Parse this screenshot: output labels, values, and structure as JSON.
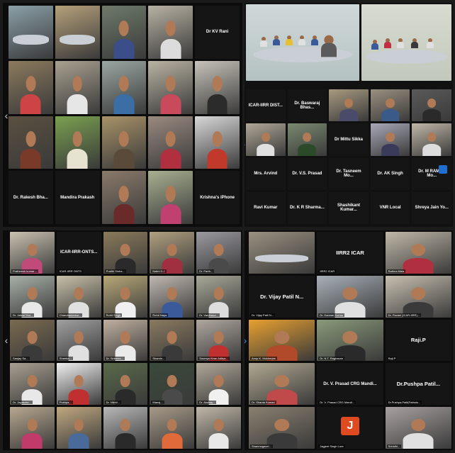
{
  "panels": {
    "top_left": {
      "tiles": [
        {
          "label": "",
          "scene": "room",
          "bg": "#8aa0a8"
        },
        {
          "label": "",
          "scene": "room",
          "bg": "#b5a07a",
          "active": true
        },
        {
          "label": "",
          "scene": "person",
          "bg": "#6e7a6a",
          "shirt": "#3b4e8a"
        },
        {
          "label": "",
          "scene": "person",
          "bg": "#b8b2a3",
          "shirt": "#dcdcdc"
        },
        {
          "name": "Dr KV Rani",
          "scene": "name"
        },
        {
          "label": "",
          "scene": "person",
          "bg": "#8c7a5e",
          "shirt": "#c44"
        },
        {
          "label": "",
          "scene": "person",
          "bg": "#a9a190",
          "shirt": "#e6e6e6"
        },
        {
          "label": "",
          "scene": "person",
          "bg": "#9aa7a3",
          "shirt": "#3b6ea5"
        },
        {
          "label": "",
          "scene": "person",
          "bg": "#b9b3a2",
          "shirt": "#c94a5a"
        },
        {
          "label": "",
          "scene": "person",
          "bg": "#c7c3ba",
          "shirt": "#2b2b2b"
        },
        {
          "label": "",
          "scene": "person",
          "bg": "#5a5040",
          "shirt": "#7a3a2a"
        },
        {
          "label": "",
          "scene": "person",
          "bg": "#7aa050",
          "shirt": "#e8e2d0"
        },
        {
          "label": "",
          "scene": "person",
          "bg": "#a89268",
          "shirt": "#5a4a3a"
        },
        {
          "label": "",
          "scene": "person",
          "bg": "#9a8a80",
          "shirt": "#b03040"
        },
        {
          "label": "",
          "scene": "person",
          "bg": "#d8d8d8",
          "shirt": "#c0392b"
        },
        {
          "name": "Dr. Rakesh Bha...",
          "scene": "name"
        },
        {
          "name": "Mandira Prakash",
          "scene": "name"
        },
        {
          "label": "",
          "scene": "person",
          "bg": "#8a7a6a",
          "shirt": "#6a2a2a"
        },
        {
          "label": "",
          "scene": "person",
          "bg": "#a8b090",
          "shirt": "#c04070"
        },
        {
          "name": "Krishna's iPhone",
          "scene": "name"
        }
      ]
    },
    "top_right": {
      "tiles": [
        {
          "name": "ICAR-IIRR DIST...",
          "scene": "name"
        },
        {
          "name": "Dr. Baswaraj Bhas...",
          "scene": "name"
        },
        {
          "label": "",
          "scene": "person",
          "bg": "#a89a80",
          "shirt": "#4a4a6a"
        },
        {
          "label": "",
          "scene": "person",
          "bg": "#9a9080",
          "shirt": "#3a5a8a"
        },
        {
          "label": "",
          "scene": "person",
          "bg": "#5a5a5a",
          "shirt": "#2a2a2a"
        },
        {
          "label": "",
          "scene": "person",
          "bg": "#b0a898",
          "shirt": "#e0e0e0"
        },
        {
          "label": "",
          "scene": "person",
          "bg": "#7a8a70",
          "shirt": "#2a4a2a"
        },
        {
          "name": "Dr Mittu Sikka",
          "scene": "name"
        },
        {
          "label": "",
          "scene": "person",
          "bg": "#a8a8b8",
          "shirt": "#3a3a5a"
        },
        {
          "label": "",
          "scene": "person",
          "bg": "#c0b8a8",
          "shirt": "#dddddd"
        },
        {
          "name": "Mrs. Arvind",
          "scene": "name"
        },
        {
          "name": "Dr. V.S. Prasad",
          "scene": "name"
        },
        {
          "name": "Dr. Tasneem Mo...",
          "scene": "name"
        },
        {
          "name": "Dr. AK Singh",
          "scene": "name"
        },
        {
          "name": "Dr. M RAMES Mo...",
          "scene": "name"
        },
        {
          "name": "Ravi Kumar",
          "scene": "name"
        },
        {
          "name": "Dr. K R Sharma...",
          "scene": "name"
        },
        {
          "name": "Shashikant Kumar...",
          "scene": "name"
        },
        {
          "name": "VNR Local",
          "scene": "name"
        },
        {
          "name": "Shreya Jain Yo...",
          "scene": "name"
        }
      ]
    },
    "bottom_left": {
      "tiles": [
        {
          "label": "Pratheesh.kumar…",
          "scene": "person",
          "bg": "#c9c2b0",
          "shirt": "#c04a7a"
        },
        {
          "name": "ICAR-IIRR-ONTS...",
          "scene": "name",
          "label": "ICAR-IIRR ONTS"
        },
        {
          "label": "Pratith Sinha...",
          "scene": "person",
          "bg": "#8a7a5a",
          "shirt": "#2a2a2a"
        },
        {
          "label": "Nalini D.J",
          "scene": "person",
          "bg": "#b0a080",
          "shirt": "#a03040"
        },
        {
          "label": "Dr. Parth...",
          "scene": "person",
          "bg": "#9a9aa0",
          "shirt": "#4a4a4a"
        },
        {
          "label": "Dr. Jaisari Kar...",
          "scene": "person",
          "bg": "#a8b0a8",
          "shirt": "#e8e8e8"
        },
        {
          "label": "Chandrashekar...",
          "scene": "person",
          "bg": "#c8c0a8",
          "shirt": "#e0e0e0"
        },
        {
          "label": "Rohit Singh",
          "scene": "person",
          "bg": "#b8a878",
          "shirt": "#f0f0f0",
          "active": true
        },
        {
          "label": "Rohit Naya",
          "scene": "person",
          "bg": "#c0b8b0",
          "shirt": "#3a5a9a"
        },
        {
          "label": "Dr. Vardhana...",
          "scene": "person",
          "bg": "#a8a898",
          "shirt": "#dddddd"
        },
        {
          "label": "Sanjay Sa...",
          "scene": "person",
          "bg": "#7a6a50",
          "shirt": "#3a3a3a"
        },
        {
          "label": "Sheeba...",
          "scene": "person",
          "bg": "#a0a0a0",
          "shirt": "#e0e0e0"
        },
        {
          "label": "Dr. Seleena...",
          "scene": "person",
          "bg": "#c0b0a0",
          "shirt": "#eaeaea"
        },
        {
          "label": "Shamin...",
          "scene": "person",
          "bg": "#8a7a60",
          "shirt": "#3a3a3a"
        },
        {
          "label": "Soumya Kiran Aditya...",
          "scene": "person",
          "bg": "#b0a8a0",
          "shirt": "#c03030"
        },
        {
          "label": "Dr. Jayasree...",
          "scene": "person",
          "bg": "#a8a090",
          "shirt": "#e8e8e8"
        },
        {
          "label": "Pushpa...",
          "scene": "person",
          "bg": "#f0f0f0",
          "shirt": "#c03030"
        },
        {
          "label": "Dr. Nikhil...",
          "scene": "person",
          "bg": "#5a6a4a",
          "shirt": "#2a2a2a"
        },
        {
          "label": "Manoj...",
          "scene": "person",
          "bg": "#3a4a3a",
          "shirt": "#4a4a4a"
        },
        {
          "label": "Dr. Akshay...",
          "scene": "person",
          "bg": "#b0a898",
          "shirt": "#f0f0f0"
        },
        {
          "label": "",
          "scene": "person",
          "bg": "#b8a890",
          "shirt": "#c03a6a"
        },
        {
          "label": "",
          "scene": "person",
          "bg": "#c0a880",
          "shirt": "#4a6a9a"
        },
        {
          "label": "",
          "scene": "person",
          "bg": "#b8b8b8",
          "shirt": "#2a2a2a"
        },
        {
          "label": "",
          "scene": "person",
          "bg": "#a89a88",
          "shirt": "#e06a3a"
        },
        {
          "label": "",
          "scene": "person",
          "bg": "#c0b8a8",
          "shirt": "#e8e8e8"
        }
      ]
    },
    "bottom_right": {
      "tiles": [
        {
          "label": "",
          "scene": "room",
          "bg": "#9a9080"
        },
        {
          "name": "IIRR2 ICAR",
          "scene": "name",
          "big": true,
          "label": "IIRR2 ICAR"
        },
        {
          "label": "Rathna Mala",
          "scene": "person",
          "bg": "#c0b8a8",
          "shirt": "#b03040"
        },
        {
          "name": "Dr. Vijay Patil N...",
          "scene": "name",
          "big": true,
          "label": "Dr. Vijay Patil N..."
        },
        {
          "label": "Dr. Kannan Kumar",
          "scene": "person",
          "bg": "#a8b0b8",
          "shirt": "#e0e0e0"
        },
        {
          "label": "Dr. Pavani (ICAR-IIRR)...",
          "scene": "person",
          "bg": "#c8c0b0",
          "shirt": "#3a3a3a"
        },
        {
          "label": "Anup K. Mukherjee",
          "scene": "person",
          "bg": "#e8a030",
          "shirt": "#b04a2a"
        },
        {
          "label": "Dr. N.T. Raghavan",
          "scene": "person",
          "bg": "#8a9a7a",
          "shirt": "#2a2a2a"
        },
        {
          "name": "Raji.P",
          "scene": "name",
          "big": true,
          "label": "Raji.P"
        },
        {
          "label": "Dr. Shanta Kumari",
          "scene": "person",
          "bg": "#b0a890",
          "shirt": "#c04a4a"
        },
        {
          "name": "Dr. V. Prasad CRG Mandi...",
          "scene": "name",
          "label": "Dr. V. Prasad CRG Mandi..."
        },
        {
          "name": "Dr.Pushpa Patil...",
          "scene": "name",
          "big": true,
          "label": "Dr.Pushpa.Patil(Patholo..."
        },
        {
          "label": "Shanmugavel...",
          "scene": "person",
          "bg": "#8a8070",
          "shirt": "#3a3a3a"
        },
        {
          "label": "Jagjeet Singh Lore",
          "scene": "j"
        },
        {
          "label": "Srinidhi...",
          "scene": "person",
          "bg": "#a8a0a0",
          "shirt": "#e0e0e0"
        }
      ]
    }
  },
  "colors": {
    "frame": "#1b1b1b",
    "tile_dark": "#151515",
    "active_border": "#f2d13a",
    "accent": "#3a8ff0"
  }
}
